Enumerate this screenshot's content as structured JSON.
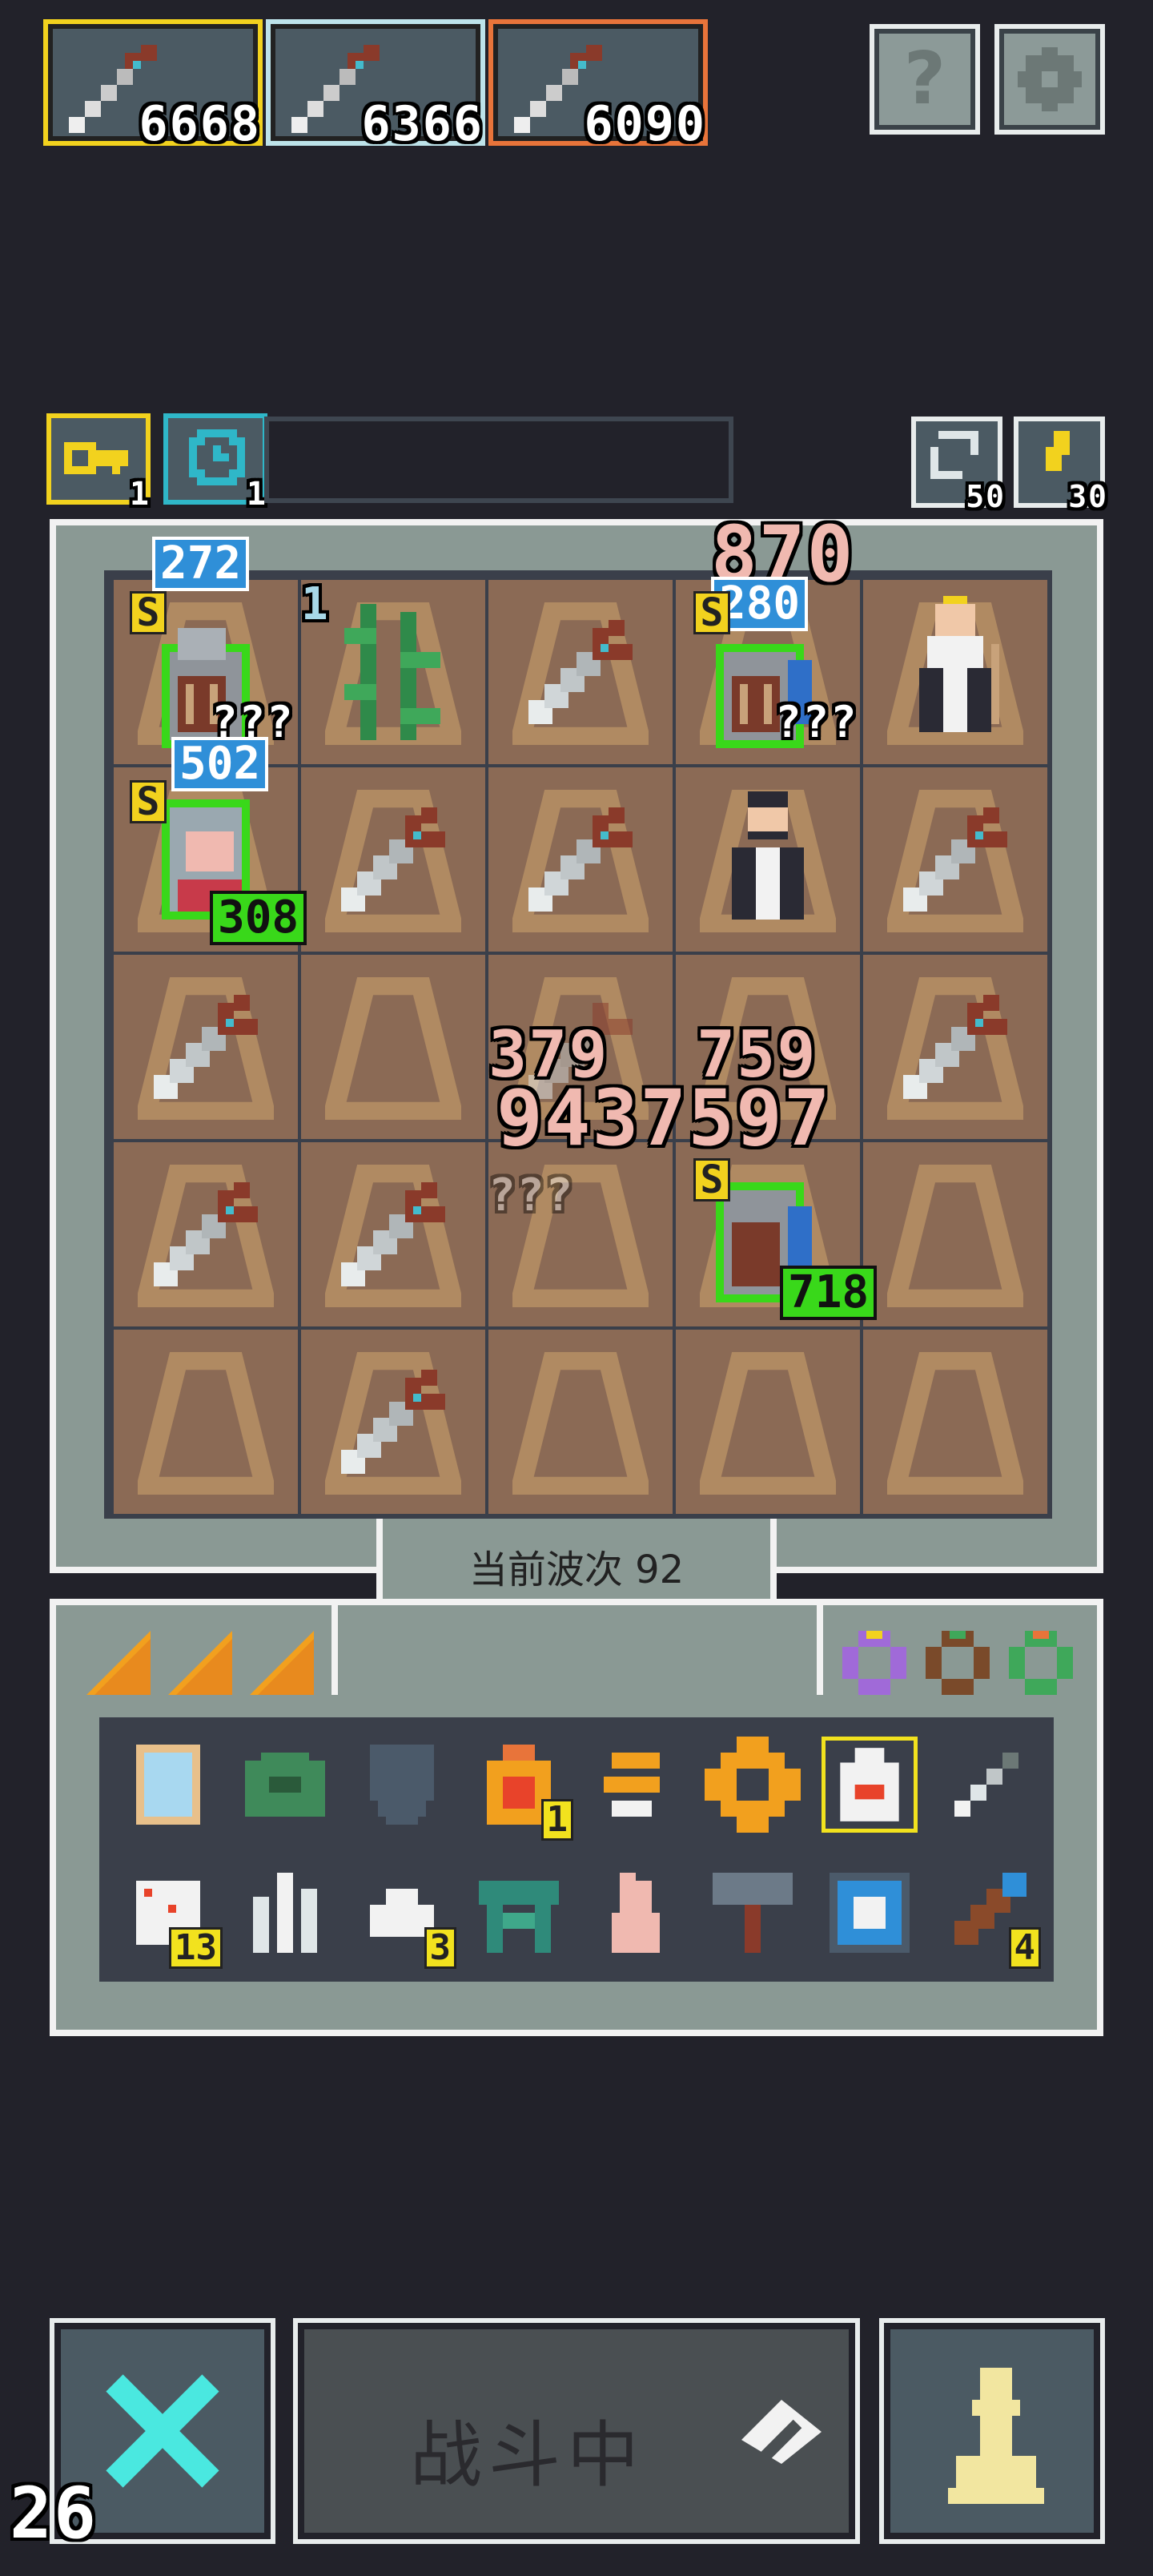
{
  "top_bar": {
    "weapon_cards": [
      {
        "value": "6668",
        "color": "#f2d21e"
      },
      {
        "value": "6366",
        "color": "#bde3ea"
      },
      {
        "value": "6090",
        "color": "#e8743a"
      }
    ],
    "help_icon": "question-mark-icon",
    "settings_icon": "gear-icon"
  },
  "status_row": {
    "key_count": "1",
    "timer_count": "1",
    "refresh_count": "50",
    "lightning_count": "30"
  },
  "board": {
    "floating_damage": {
      "top_pink": "870",
      "center_big": "9437597",
      "center_left": "379",
      "center_right": "759"
    },
    "units": [
      {
        "blue": "272",
        "s": "S",
        "green": "",
        "question": "???"
      },
      {
        "blue": "280",
        "s": "S",
        "green": "",
        "question": "???"
      },
      {
        "blue": "502",
        "s": "S",
        "green": "308",
        "question": ""
      },
      {
        "blue": "",
        "s": "S",
        "green": "718",
        "question": ""
      }
    ],
    "plant_level": "1",
    "ghost_question": "???"
  },
  "wave": {
    "label": "当前波次 92"
  },
  "inventory": {
    "row1": [
      {
        "name": "mirror-scroll-icon",
        "count": ""
      },
      {
        "name": "green-turtle-shell-icon",
        "count": ""
      },
      {
        "name": "shield-icon",
        "count": ""
      },
      {
        "name": "fire-potion-icon",
        "count": "1"
      },
      {
        "name": "claw-icon",
        "count": ""
      },
      {
        "name": "gear-medal-icon",
        "count": ""
      },
      {
        "name": "white-vase-icon",
        "count": ""
      },
      {
        "name": "dagger-icon",
        "count": ""
      }
    ],
    "row2": [
      {
        "name": "dice-icon",
        "count": "13"
      },
      {
        "name": "white-crystal-icon",
        "count": ""
      },
      {
        "name": "cloud-icon",
        "count": "3"
      },
      {
        "name": "altar-icon",
        "count": ""
      },
      {
        "name": "hand-gesture-icon",
        "count": ""
      },
      {
        "name": "hammer-icon",
        "count": ""
      },
      {
        "name": "portrait-frame-icon",
        "count": ""
      },
      {
        "name": "telescope-icon",
        "count": "4"
      }
    ]
  },
  "bottom_bar": {
    "battle_label": "战斗中",
    "timer": "26"
  }
}
